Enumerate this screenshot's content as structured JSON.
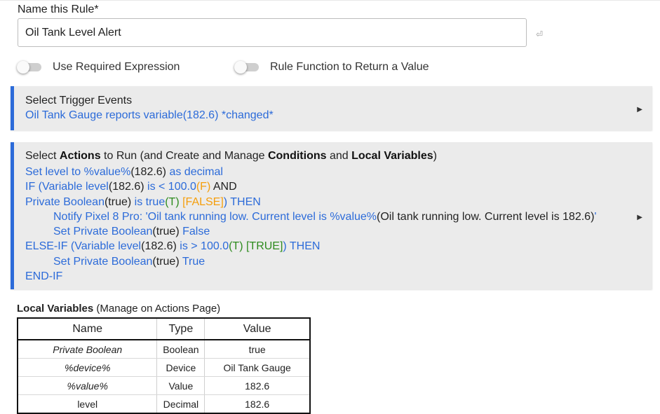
{
  "rule_name": {
    "label": "Name this Rule*",
    "value": "Oil Tank Level Alert"
  },
  "toggles": [
    {
      "label": "Use Required Expression",
      "on": false
    },
    {
      "label": "Rule Function to Return a Value",
      "on": false
    }
  ],
  "trigger_panel": {
    "title": "Select Trigger Events",
    "line": "Oil Tank Gauge reports variable(182.6) *changed*"
  },
  "actions_panel": {
    "title_parts": [
      "Select ",
      "Actions",
      " to Run (and Create and Manage ",
      "Conditions",
      " and ",
      "Local Variables",
      ")"
    ],
    "lines": [
      {
        "indent": 0,
        "segments": [
          {
            "t": "Set level to %value%",
            "c": "b"
          },
          {
            "t": "(182.6)",
            "c": "k"
          },
          {
            "t": " as decimal",
            "c": "b"
          }
        ]
      },
      {
        "indent": 0,
        "segments": [
          {
            "t": "IF (Variable level",
            "c": "b"
          },
          {
            "t": "(182.6)",
            "c": "k"
          },
          {
            "t": " is < 100.0",
            "c": "b"
          },
          {
            "t": "(F)",
            "c": "o"
          },
          {
            "t": "  AND",
            "c": "k"
          }
        ]
      },
      {
        "indent": 0,
        "segments": [
          {
            "t": "Private Boolean",
            "c": "b"
          },
          {
            "t": "(true)",
            "c": "k"
          },
          {
            "t": " is true",
            "c": "b"
          },
          {
            "t": "(T)",
            "c": "g"
          },
          {
            "t": " [FALSE]",
            "c": "o"
          },
          {
            "t": ") THEN",
            "c": "b"
          }
        ]
      },
      {
        "indent": 1,
        "segments": [
          {
            "t": "Notify Pixel 8 Pro: 'Oil tank running low. Current level is %value%",
            "c": "b"
          },
          {
            "t": "(Oil tank running low. Current level is 182.6)",
            "c": "k"
          },
          {
            "t": "'",
            "c": "b"
          }
        ]
      },
      {
        "indent": 1,
        "segments": [
          {
            "t": "Set Private Boolean",
            "c": "b"
          },
          {
            "t": "(true)",
            "c": "k"
          },
          {
            "t": " False",
            "c": "b"
          }
        ]
      },
      {
        "indent": 0,
        "segments": [
          {
            "t": "ELSE-IF (Variable level",
            "c": "b"
          },
          {
            "t": "(182.6)",
            "c": "k"
          },
          {
            "t": " is > 100.0",
            "c": "b"
          },
          {
            "t": "(T) [TRUE]",
            "c": "g"
          },
          {
            "t": ") THEN",
            "c": "b"
          }
        ]
      },
      {
        "indent": 1,
        "segments": [
          {
            "t": "Set Private Boolean",
            "c": "b"
          },
          {
            "t": "(true)",
            "c": "k"
          },
          {
            "t": " True",
            "c": "b"
          }
        ]
      },
      {
        "indent": 0,
        "segments": [
          {
            "t": "END-IF",
            "c": "b"
          }
        ]
      }
    ]
  },
  "local_variables": {
    "title": "Local Variables",
    "subtitle": " (Manage on Actions Page)",
    "columns": [
      "Name",
      "Type",
      "Value"
    ],
    "rows": [
      {
        "name": "Private Boolean",
        "type": "Boolean",
        "value": "true",
        "italic": true
      },
      {
        "name": "%device%",
        "type": "Device",
        "value": "Oil Tank Gauge",
        "italic": true
      },
      {
        "name": "%value%",
        "type": "Value",
        "value": "182.6",
        "italic": true
      },
      {
        "name": "level",
        "type": "Decimal",
        "value": "182.6",
        "italic": false
      }
    ]
  },
  "icons": {
    "expand": "triangle-right-icon",
    "return": "return-key-icon"
  },
  "colors": {
    "accent": "#2c6bd9",
    "false_orange": "#f59e0b",
    "true_green": "#2e8b1e",
    "panel_bg": "#ebebeb"
  }
}
